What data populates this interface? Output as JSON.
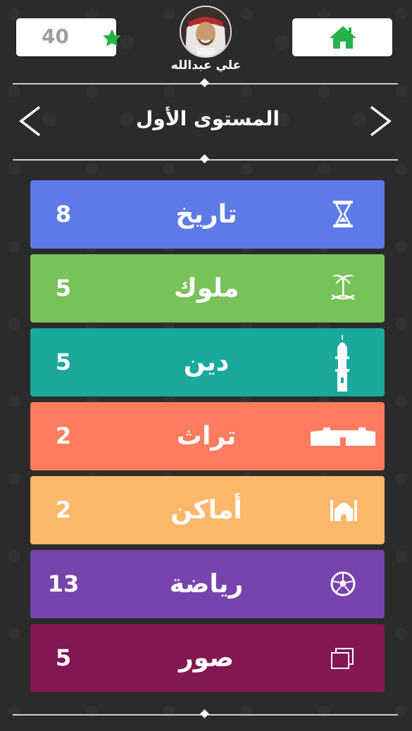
{
  "header": {
    "score": "40",
    "username": "علي عبدالله"
  },
  "level": {
    "title": "المستوى الأول"
  },
  "categories": [
    {
      "name": "تاريخ",
      "count": "8",
      "color": "#5e7ae6",
      "icon": "hourglass-icon"
    },
    {
      "name": "ملوك",
      "count": "5",
      "color": "#78c25a",
      "icon": "palm-swords-icon"
    },
    {
      "name": "دين",
      "count": "5",
      "color": "#1aa99d",
      "icon": "minaret-icon"
    },
    {
      "name": "تراث",
      "count": "2",
      "color": "#fd7b5e",
      "icon": "fort-icon"
    },
    {
      "name": "أماكن",
      "count": "2",
      "color": "#fdb76a",
      "icon": "mosque-icon"
    },
    {
      "name": "رياضة",
      "count": "13",
      "color": "#7743ac",
      "icon": "soccer-ball-icon"
    },
    {
      "name": "صور",
      "count": "5",
      "color": "#821752",
      "icon": "photos-icon"
    }
  ],
  "colors": {
    "background": "#2b2b2b",
    "accent_green": "#27b24a"
  }
}
